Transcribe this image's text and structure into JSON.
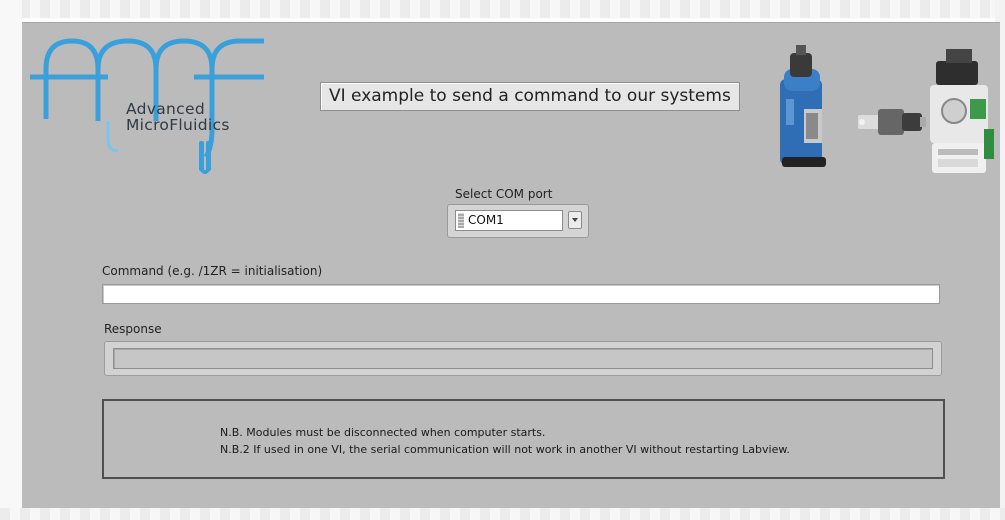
{
  "header": {
    "logo_line1": "Advanced",
    "logo_line2": "MicroFluidics",
    "title": "VI example to send a command to our systems"
  },
  "com_port": {
    "label": "Select COM port",
    "value": "COM1"
  },
  "command": {
    "label": "Command (e.g. /1ZR = initialisation)",
    "value": ""
  },
  "response": {
    "label": "Response",
    "value": ""
  },
  "notes": {
    "line1": "N.B. Modules must be disconnected when computer starts.",
    "line2": "N.B.2 If used in one VI, the serial communication will not work in another VI without restarting Labview."
  },
  "colors": {
    "panel_bg": "#bbbbbb",
    "logo_blue": "#3aa0dc"
  }
}
